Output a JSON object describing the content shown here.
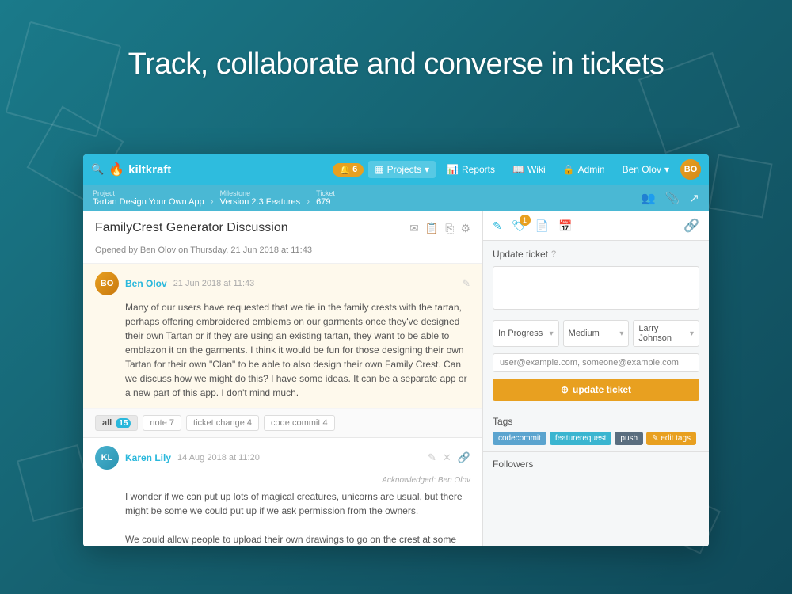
{
  "hero": {
    "title": "Track, collaborate and converse in tickets"
  },
  "nav": {
    "logo_icon": "🔥",
    "logo_text": "kiltkraft",
    "bell_count": "6",
    "projects_label": "Projects",
    "reports_label": "Reports",
    "wiki_label": "Wiki",
    "admin_label": "Admin",
    "user_label": "Ben Olov",
    "user_initials": "BO"
  },
  "breadcrumb": {
    "project_label": "Project",
    "project_value": "Tartan Design Your Own App",
    "milestone_label": "Milestone",
    "milestone_value": "Version 2.3 Features",
    "ticket_label": "Ticket",
    "ticket_value": "679"
  },
  "discussion": {
    "title": "FamilyCrest Generator Discussion",
    "opened_by": "Opened by Ben Olov on Thursday, 21 Jun 2018 at 11:43"
  },
  "comment1": {
    "author": "Ben Olov",
    "date": "21 Jun 2018 at 11:43",
    "initials": "BO",
    "body": "Many of our users have requested that we tie in the family crests with the tartan, perhaps offering embroidered emblems on our garments once they've designed their own Tartan or if they are using an existing tartan, they want to be able to emblazon it on the garments. I think it would be fun for those designing their own Tartan for their own \"Clan\" to be able to also design their own Family Crest. Can we discuss how we might do this? I have some ideas. It can be a separate app or a new part of this app. I don't mind much."
  },
  "tabs": {
    "all_label": "all",
    "all_count": "15",
    "note_label": "note",
    "note_count": "7",
    "ticket_change_label": "ticket change",
    "ticket_change_count": "4",
    "code_commit_label": "code commit",
    "code_commit_count": "4"
  },
  "comment2": {
    "author": "Karen Lily",
    "date": "14 Aug 2018 at 11:20",
    "initials": "KL",
    "acknowledged": "Acknowledged: Ben Olov",
    "body1": "I wonder if we can put up lots of magical creatures, unicorns are usual, but there might be some we could put up if we ask permission from the owners.",
    "body2": "We could allow people to upload their own drawings to go on the crest at some point. Don't"
  },
  "right_panel": {
    "update_label": "Update ticket",
    "textarea_placeholder": "",
    "status_label": "In Progress",
    "priority_label": "Medium",
    "assignee_label": "Larry Johnson",
    "email_value": "user@example.com, someone@example.com",
    "update_btn_label": "update ticket",
    "tags_label": "Tags",
    "tag1": "codecommit",
    "tag2": "featurerequest",
    "tag3": "push",
    "edit_tags_label": "✎ edit tags",
    "followers_label": "Followers"
  }
}
